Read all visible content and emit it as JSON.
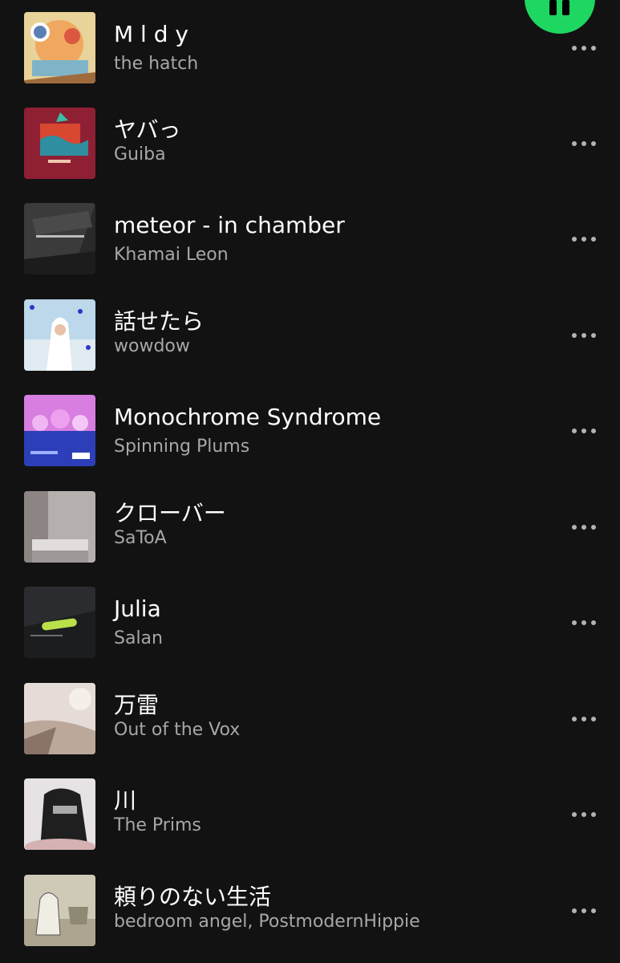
{
  "accent_color": "#1ed760",
  "header": {
    "pause_button_icon": "pause-icon"
  },
  "tracks": [
    {
      "title": "M l d y",
      "artist": "the hatch"
    },
    {
      "title": "ヤバっ",
      "artist": "Guiba"
    },
    {
      "title": "meteor - in chamber",
      "artist": "Khamai Leon"
    },
    {
      "title": "話せたら",
      "artist": "wowdow"
    },
    {
      "title": "Monochrome Syndrome",
      "artist": "Spinning Plums"
    },
    {
      "title": "クローバー",
      "artist": "SaToA"
    },
    {
      "title": "Julia",
      "artist": "Salan"
    },
    {
      "title": "万雷",
      "artist": "Out of the Vox"
    },
    {
      "title": "川",
      "artist": "The Prims"
    },
    {
      "title": "頼りのない生活",
      "artist": "bedroom angel, PostmodernHippie"
    }
  ],
  "track_menu_icon": "more-options-icon"
}
